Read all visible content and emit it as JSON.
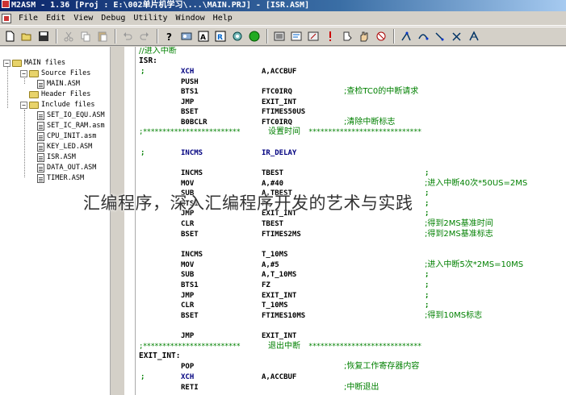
{
  "window": {
    "title": "M2ASM - 1.36  [Proj : E:\\002单片机学习\\...\\MAIN.PRJ]  - [ISR.ASM]"
  },
  "menu": {
    "items": [
      "File",
      "Edit",
      "View",
      "Debug",
      "Utility",
      "Window",
      "Help"
    ]
  },
  "project_tree": {
    "root": "MAIN files",
    "source_folder": "Source Files",
    "source_files": [
      "MAIN.ASM"
    ],
    "header_folder": "Header Files",
    "include_folder": "Include files",
    "include_files": [
      "SET_IO_EQU.ASM",
      "SET_IC_RAM.asm",
      "CPU_INIT.asm",
      "KEY_LED.ASM",
      "ISR.ASM",
      "DATA_OUT.ASM",
      "TIMER.ASM"
    ]
  },
  "code": {
    "l01_comment": "//进入中断",
    "l02_label": "ISR:",
    "l03_op": "XCH",
    "l03_arg": "A,ACCBUF",
    "l04_op": "PUSH",
    "l05_op": "BTS1",
    "l05_arg": "FTC0IRQ",
    "l05_comment": ";查检TC0的中断请求",
    "l06_op": "JMP",
    "l06_arg": "EXIT_INT",
    "l07_op": "BSET",
    "l07_arg": "FTIMES50US",
    "l08_op": "B0BCLR",
    "l08_arg": "FTC0IRQ",
    "l08_comment": ";清除中断标志",
    "l09_stars_left": ";*************************",
    "l09_text": "设置时间",
    "l09_stars_right": "*****************************",
    "l10_op": "INCMS",
    "l10_arg": "IR_DELAY",
    "l11_op": "INCMS",
    "l11_arg": "TBEST",
    "l12_op": "MOV",
    "l12_arg": "A,#40",
    "l12_comment": ";进入中断40次*50US=2MS",
    "l13_op": "SUB",
    "l13_arg": "A,TBEST",
    "l14_op": "BTS1",
    "l14_arg": "FC",
    "l15_op": "JMP",
    "l15_arg": "EXIT_INT",
    "l16_op": "CLR",
    "l16_arg": "TBEST",
    "l16_comment": ";得到2MS基准时间",
    "l17_op": "BSET",
    "l17_arg": "FTIMES2MS",
    "l17_comment": ";得到2MS基准标志",
    "l18_op": "INCMS",
    "l18_arg": "T_10MS",
    "l19_op": "MOV",
    "l19_arg": "A,#5",
    "l19_comment": ";进入中断5次*2MS=10MS",
    "l20_op": "SUB",
    "l20_arg": "A,T_10MS",
    "l21_op": "BTS1",
    "l21_arg": "FZ",
    "l22_op": "JMP",
    "l22_arg": "EXIT_INT",
    "l23_op": "CLR",
    "l23_arg": "T_10MS",
    "l24_op": "BSET",
    "l24_arg": "FTIMES10MS",
    "l24_comment": ";得到10MS标志",
    "l25_op": "JMP",
    "l25_arg": "EXIT_INT",
    "l26_stars_left": ";*************************",
    "l26_text": "退出中断",
    "l26_stars_right": "*****************************",
    "l27_label": "EXIT_INT:",
    "l28_op": "POP",
    "l28_comment": ";恢复工作寄存器内容",
    "l29_op": "XCH",
    "l29_arg": "A,ACCBUF",
    "l30_op": "RETI",
    "l30_comment": ";中断退出"
  },
  "watermark": "汇编程序，深入汇编程序开发的艺术与实践"
}
